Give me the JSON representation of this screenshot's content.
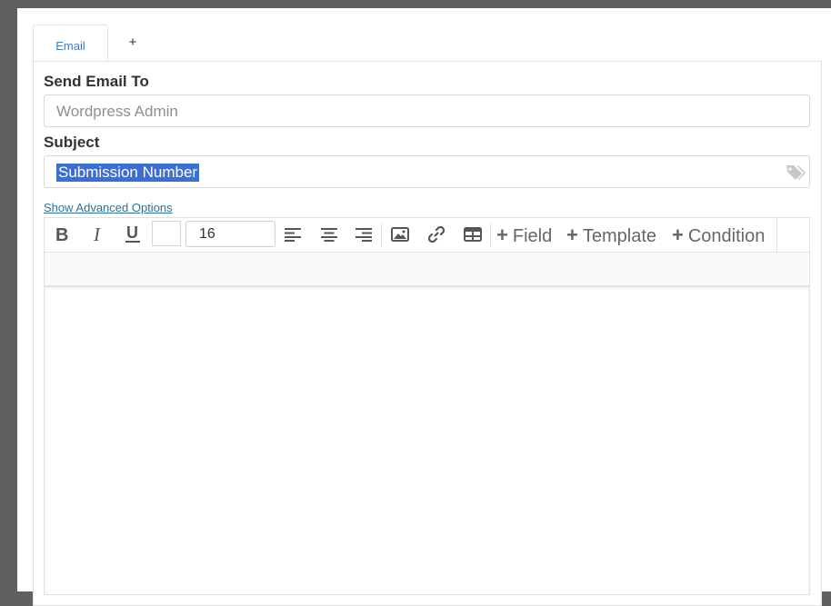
{
  "tabs": [
    {
      "label": "Email",
      "active": true
    },
    {
      "label": "+"
    }
  ],
  "send_to": {
    "label": "Send Email To",
    "placeholder": "Wordpress Admin"
  },
  "subject": {
    "label": "Subject",
    "value": "Submission Number",
    "icon": "tags-icon"
  },
  "advanced_link": "Show Advanced Options",
  "editor": {
    "font_size": "16",
    "buttons": {
      "field": "Field",
      "template": "Template",
      "condition": "Condition"
    },
    "plus_glyph": "+"
  },
  "colors": {
    "accent": "#3a7bd5",
    "selection": "#3b6fd4",
    "link": "#2e6f9e",
    "background": "#606060"
  }
}
